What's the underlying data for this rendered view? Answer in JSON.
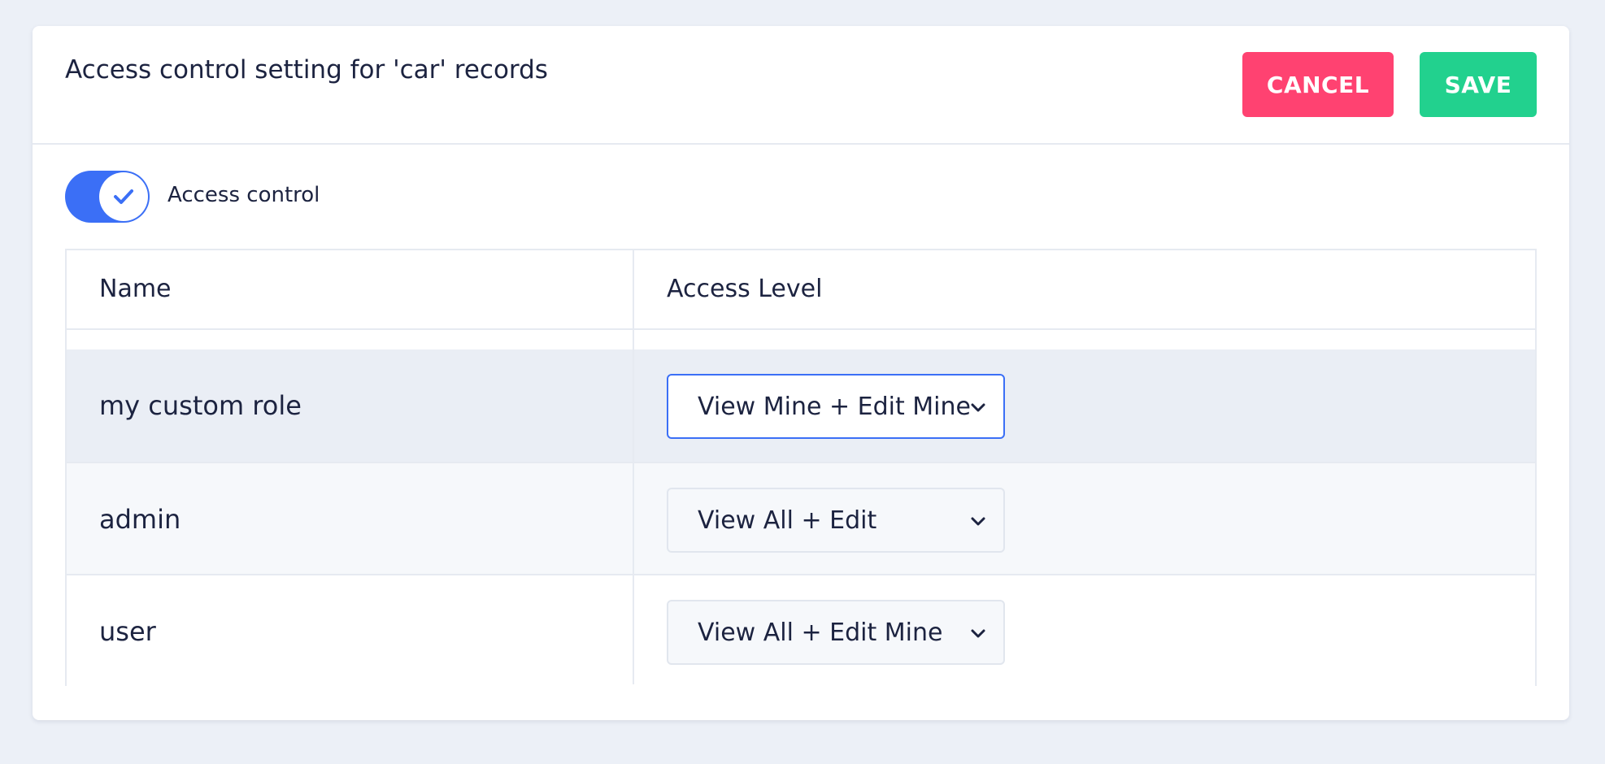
{
  "header": {
    "title": "Access control setting for 'car' records",
    "cancel_label": "CANCEL",
    "save_label": "SAVE"
  },
  "toggle": {
    "label": "Access control",
    "enabled": true,
    "icon": "check-icon"
  },
  "table": {
    "columns": [
      "Name",
      "Access Level"
    ],
    "rows": [
      {
        "name": "my custom role",
        "access_level": "View Mine + Edit Mine",
        "focused": true
      },
      {
        "name": "admin",
        "access_level": "View All + Edit",
        "focused": false
      },
      {
        "name": "user",
        "access_level": "View All + Edit Mine",
        "focused": false
      }
    ]
  },
  "colors": {
    "background": "#ecf0f7",
    "cancel": "#ff4271",
    "save": "#22d18e",
    "toggle_on": "#3b6ff6",
    "row_highlight": "#eaeef5",
    "row_alt": "#f6f8fb",
    "select_focus_border": "#3b6ff6"
  }
}
